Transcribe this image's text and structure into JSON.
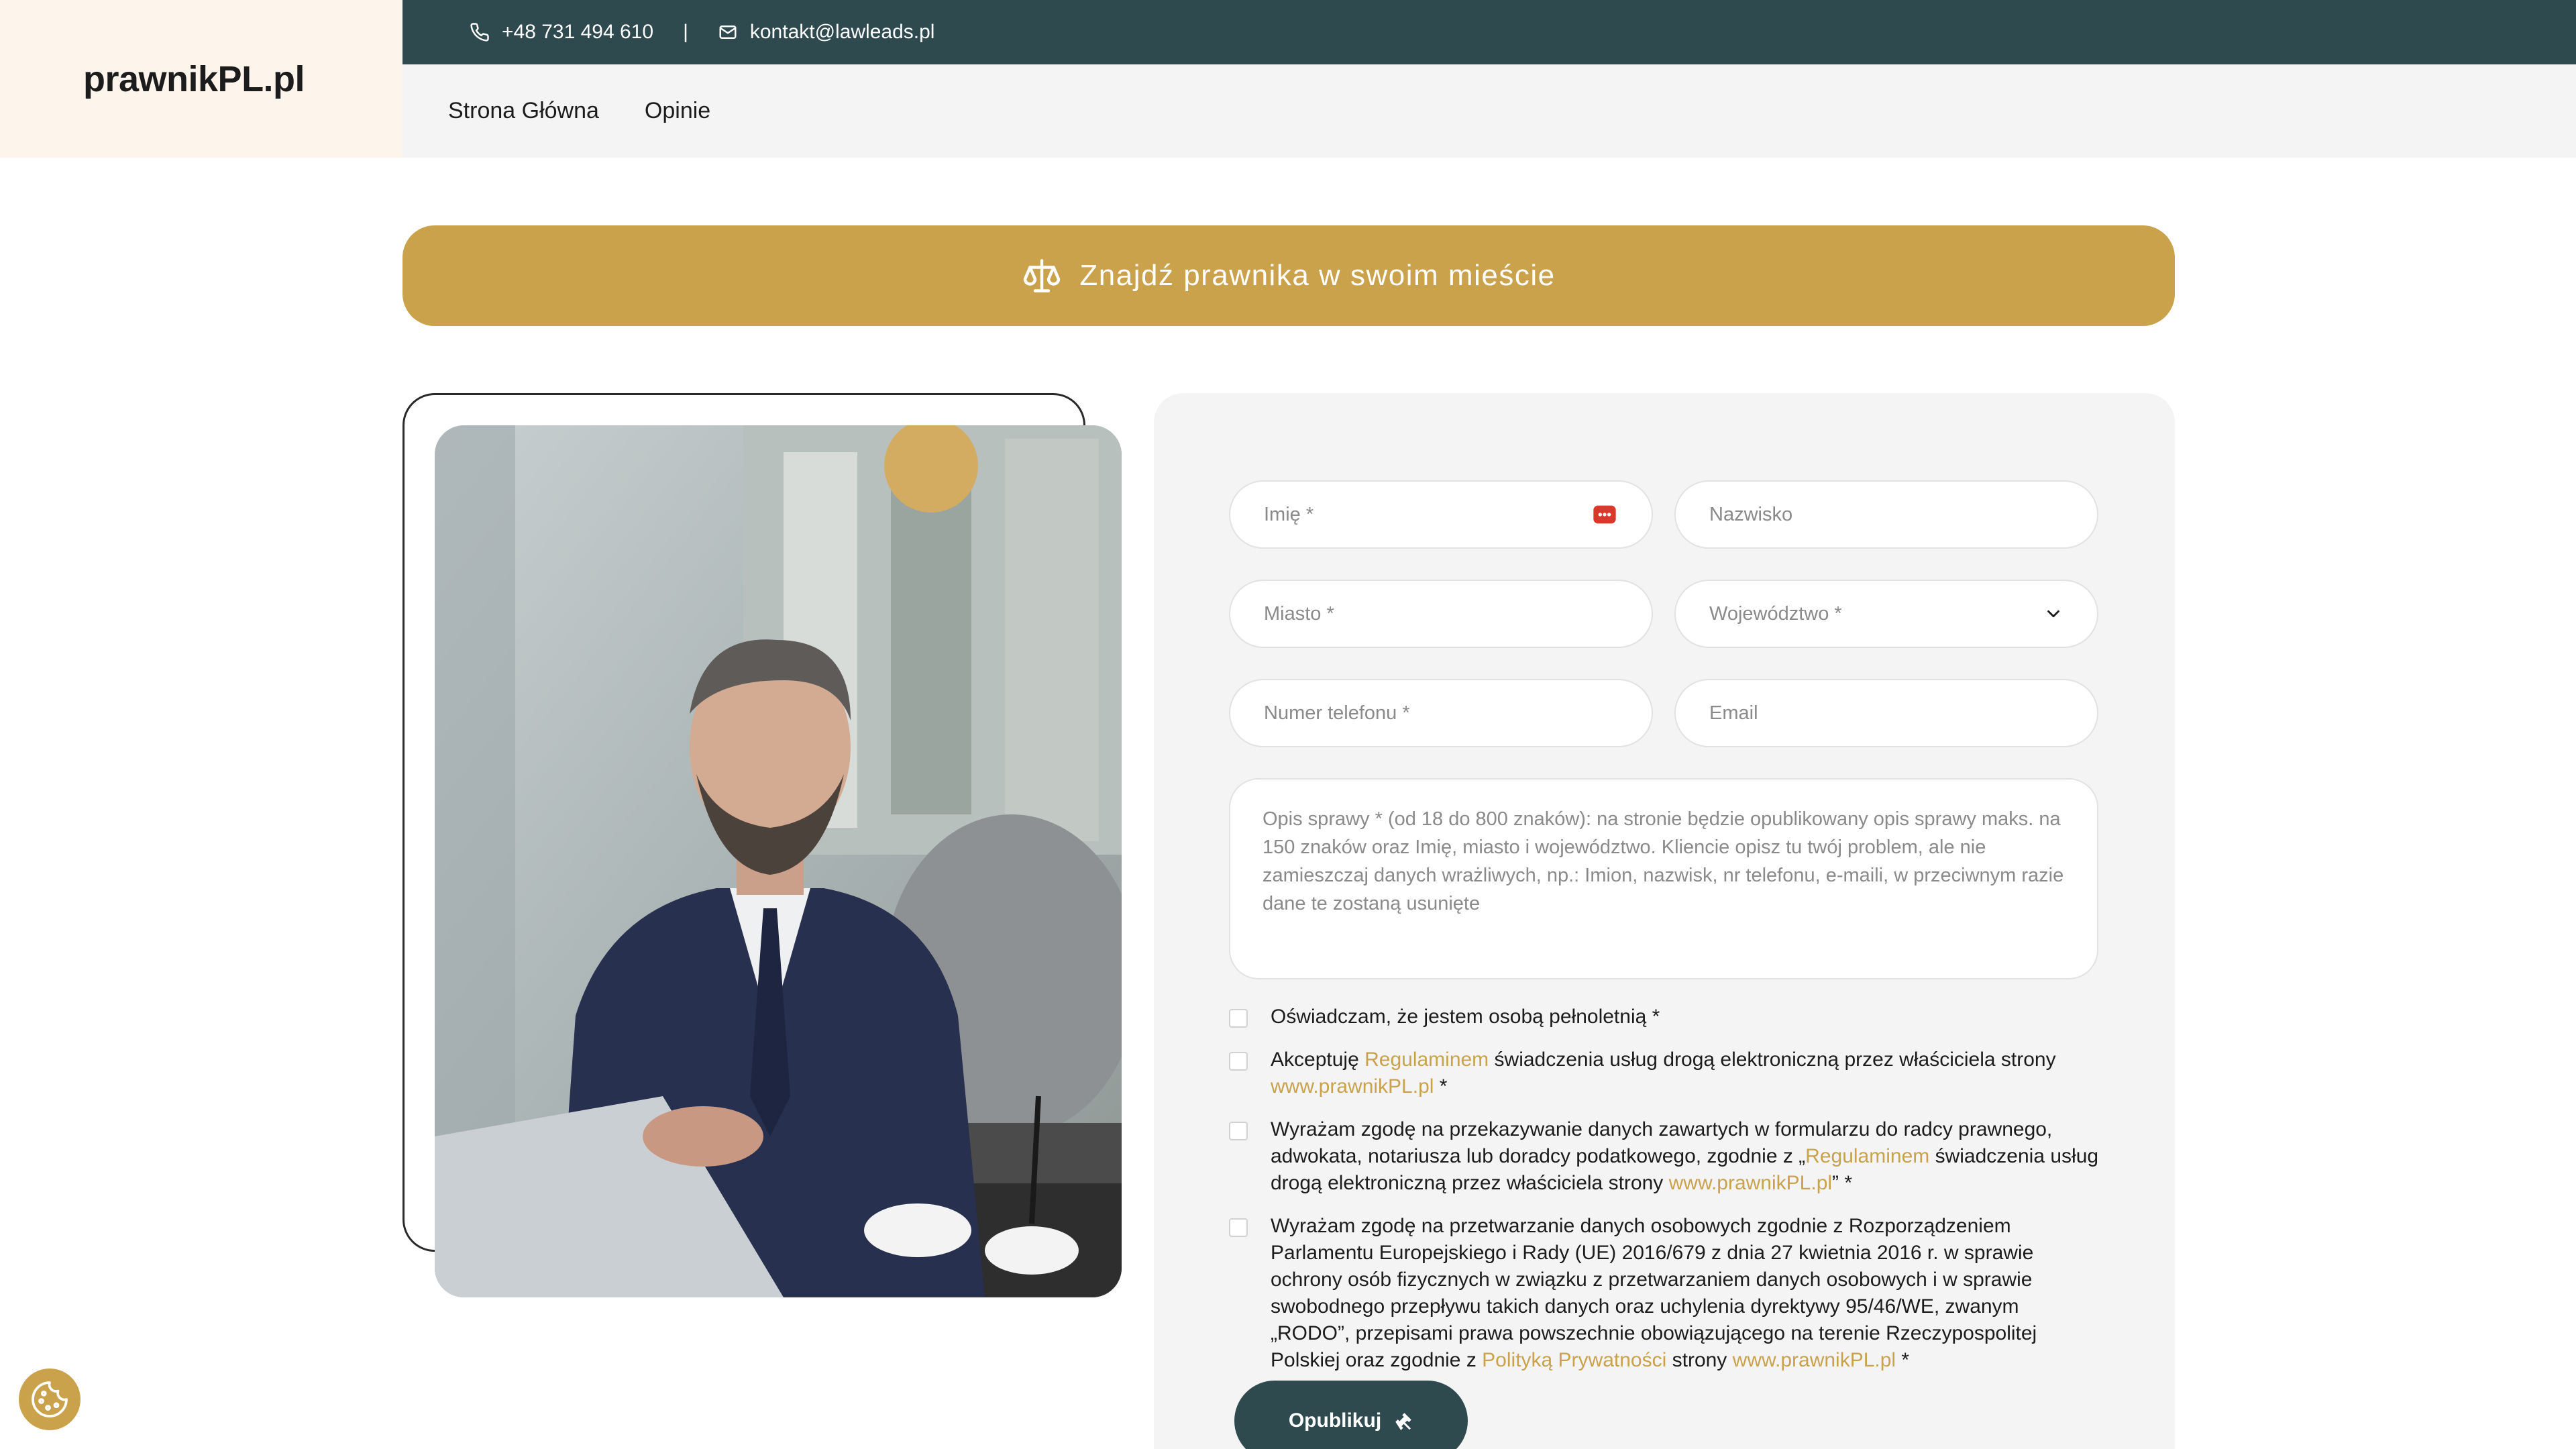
{
  "header": {
    "logo": "prawnikPL.pl",
    "phone": "+48 731 494 610",
    "separator": "|",
    "email": "kontakt@lawleads.pl",
    "nav": [
      {
        "label": "Strona Główna"
      },
      {
        "label": "Opinie"
      }
    ]
  },
  "banner": {
    "icon": "scales-icon",
    "title": "Znajdź prawnika w swoim mieście"
  },
  "form": {
    "first_name_placeholder": "Imię *",
    "last_name_placeholder": "Nazwisko",
    "city_placeholder": "Miasto *",
    "voivodeship_placeholder": "Województwo *",
    "phone_placeholder": "Numer telefonu *",
    "email_placeholder": "Email",
    "description_placeholder": "Opis sprawy * (od 18 do 800 znaków): na stronie będzie opublikowany opis sprawy maks. na 150 znaków oraz Imię, miasto i województwo. Kliencie opisz tu twój problem, ale nie zamieszczaj danych wrażliwych, np.: Imion, nazwisk, nr telefonu, e-maili, w przeciwnym razie dane te zostaną usunięte",
    "consents": {
      "c1": "Oświadczam, że jestem osobą pełnoletnią *",
      "c2_pre": "Akceptuję ",
      "c2_link1": "Regulaminem",
      "c2_mid": " świadczenia usług drogą elektroniczną przez właściciela strony ",
      "c2_link2": "www.prawnikPL.pl",
      "c2_post": " *",
      "c3_pre": "Wyrażam zgodę na przekazywanie danych zawartych w formularzu do radcy prawnego, adwokata, notariusza lub doradcy podatkowego, zgodnie z „",
      "c3_link1": "Regulaminem",
      "c3_mid": " świadczenia usług drogą elektroniczną przez właściciela strony ",
      "c3_link2": "www.prawnikPL.pl",
      "c3_post": "” *",
      "c4_pre": "Wyrażam zgodę na przetwarzanie danych osobowych zgodnie z Rozporządzeniem Parlamentu Europejskiego i Rady (UE) 2016/679 z dnia 27 kwietnia 2016 r. w sprawie ochrony osób fizycznych w związku z przetwarzaniem danych osobowych i w sprawie swobodnego przepływu takich danych oraz uchylenia dyrektywy 95/46/WE, zwanym „RODO”, przepisami prawa powszechnie obowiązującego na terenie Rzeczypospolitej Polskiej oraz zgodnie z ",
      "c4_link1": "Polityką Prywatności",
      "c4_mid": " strony ",
      "c4_link2": "www.prawnikPL.pl",
      "c4_post": " *"
    },
    "submit_label": "Opublikuj"
  },
  "colors": {
    "accent": "#c9a24b",
    "dark": "#2f4a4f",
    "logo_bg": "#fdf4ec",
    "panel_bg": "#f4f4f4"
  }
}
